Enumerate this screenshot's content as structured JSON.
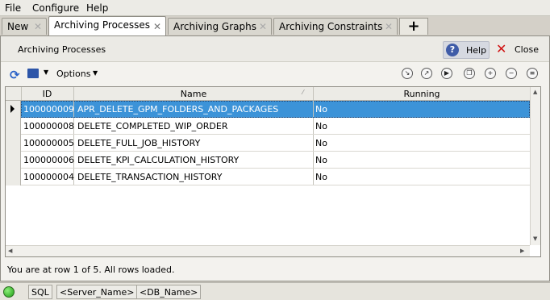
{
  "menu": [
    {
      "label": "File"
    },
    {
      "label": "Configure"
    },
    {
      "label": "Help"
    }
  ],
  "tabs": [
    {
      "label": "New",
      "active": false
    },
    {
      "label": "Archiving Processes",
      "active": true
    },
    {
      "label": "Archiving Graphs",
      "active": false
    },
    {
      "label": "Archiving Constraints",
      "active": false
    }
  ],
  "tab_add_label": "+",
  "panel": {
    "title": "Archiving Processes",
    "help_label": "Help",
    "close_label": "Close"
  },
  "toolbar": {
    "options_label": "Options",
    "icons": [
      "refresh-icon",
      "print-icon",
      "export-icon",
      "open-external-icon",
      "run-icon",
      "copy-icon",
      "add-icon",
      "remove-icon",
      "list-icon"
    ]
  },
  "grid": {
    "columns": [
      "ID",
      "Name",
      "Running"
    ],
    "sort_column": "Name",
    "rows": [
      {
        "id": "100000009",
        "name": "APR_DELETE_GPM_FOLDERS_AND_PACKAGES",
        "running": "No"
      },
      {
        "id": "100000008",
        "name": "DELETE_COMPLETED_WIP_ORDER",
        "running": "No"
      },
      {
        "id": "100000005",
        "name": "DELETE_FULL_JOB_HISTORY",
        "running": "No"
      },
      {
        "id": "100000006",
        "name": "DELETE_KPI_CALCULATION_HISTORY",
        "running": "No"
      },
      {
        "id": "100000004",
        "name": "DELETE_TRANSACTION_HISTORY",
        "running": "No"
      }
    ],
    "selected_row": 0
  },
  "status_message": "You are at row 1 of 5. All rows loaded.",
  "statusbar": {
    "connection_color": "#22a318",
    "sql_label": "SQL",
    "server": "<Server_Name>",
    "db": "<DB_Name>"
  },
  "colors": {
    "selection": "#3c93d8",
    "help_button": "#d6d9e1",
    "close_icon": "#d01010"
  }
}
